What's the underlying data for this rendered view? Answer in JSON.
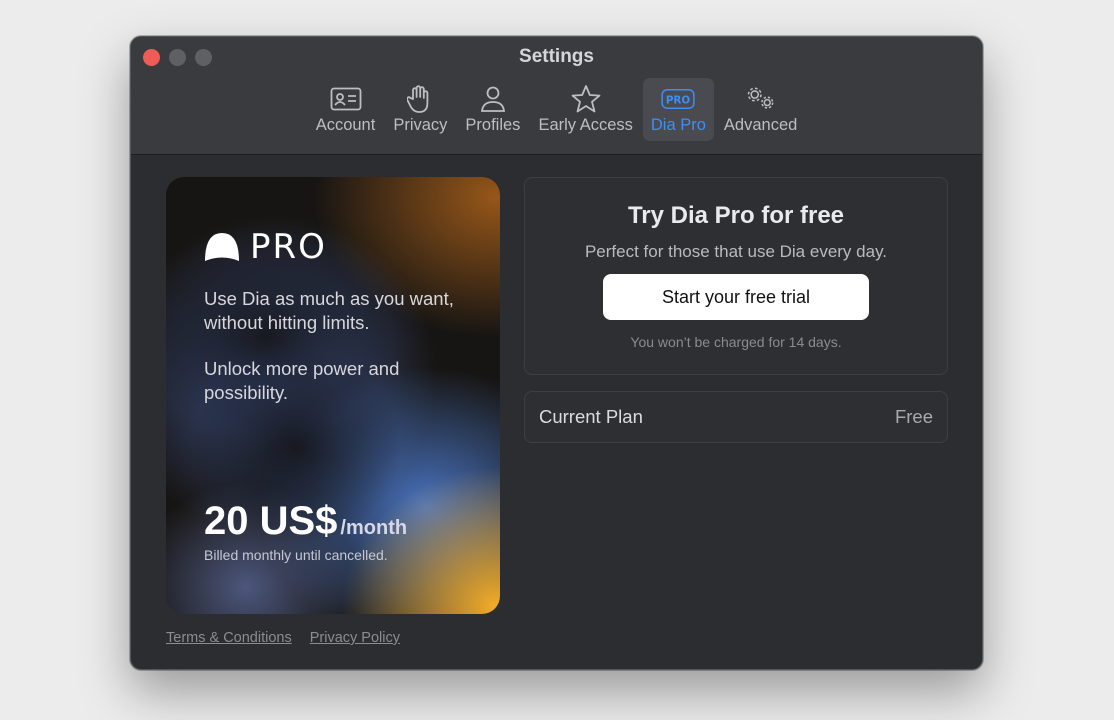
{
  "window": {
    "title": "Settings"
  },
  "tabs": [
    {
      "label": "Account",
      "icon": "contact-card-icon"
    },
    {
      "label": "Privacy",
      "icon": "hand-icon"
    },
    {
      "label": "Profiles",
      "icon": "person-icon"
    },
    {
      "label": "Early Access",
      "icon": "star-icon"
    },
    {
      "label": "Dia Pro",
      "icon": "pro-badge-icon",
      "active": true,
      "badge": "PRO"
    },
    {
      "label": "Advanced",
      "icon": "gears-icon"
    }
  ],
  "promo": {
    "logo_text": "PRO",
    "line1": "Use Dia as much as you want, without hitting limits.",
    "line2": "Unlock more power and possibility.",
    "price": "20 US$",
    "period": "/month",
    "billing": "Billed monthly until cancelled."
  },
  "links": {
    "terms": "Terms & Conditions",
    "privacy": "Privacy Policy"
  },
  "trial": {
    "heading": "Try Dia Pro for free",
    "subtitle": "Perfect for those that use Dia every day.",
    "button": "Start your free trial",
    "note": "You won’t be charged for 14 days."
  },
  "plan": {
    "label": "Current Plan",
    "value": "Free"
  },
  "colors": {
    "accent": "#3e8ef7",
    "close": "#ee5c55",
    "window_bg": "#2c2d31"
  }
}
